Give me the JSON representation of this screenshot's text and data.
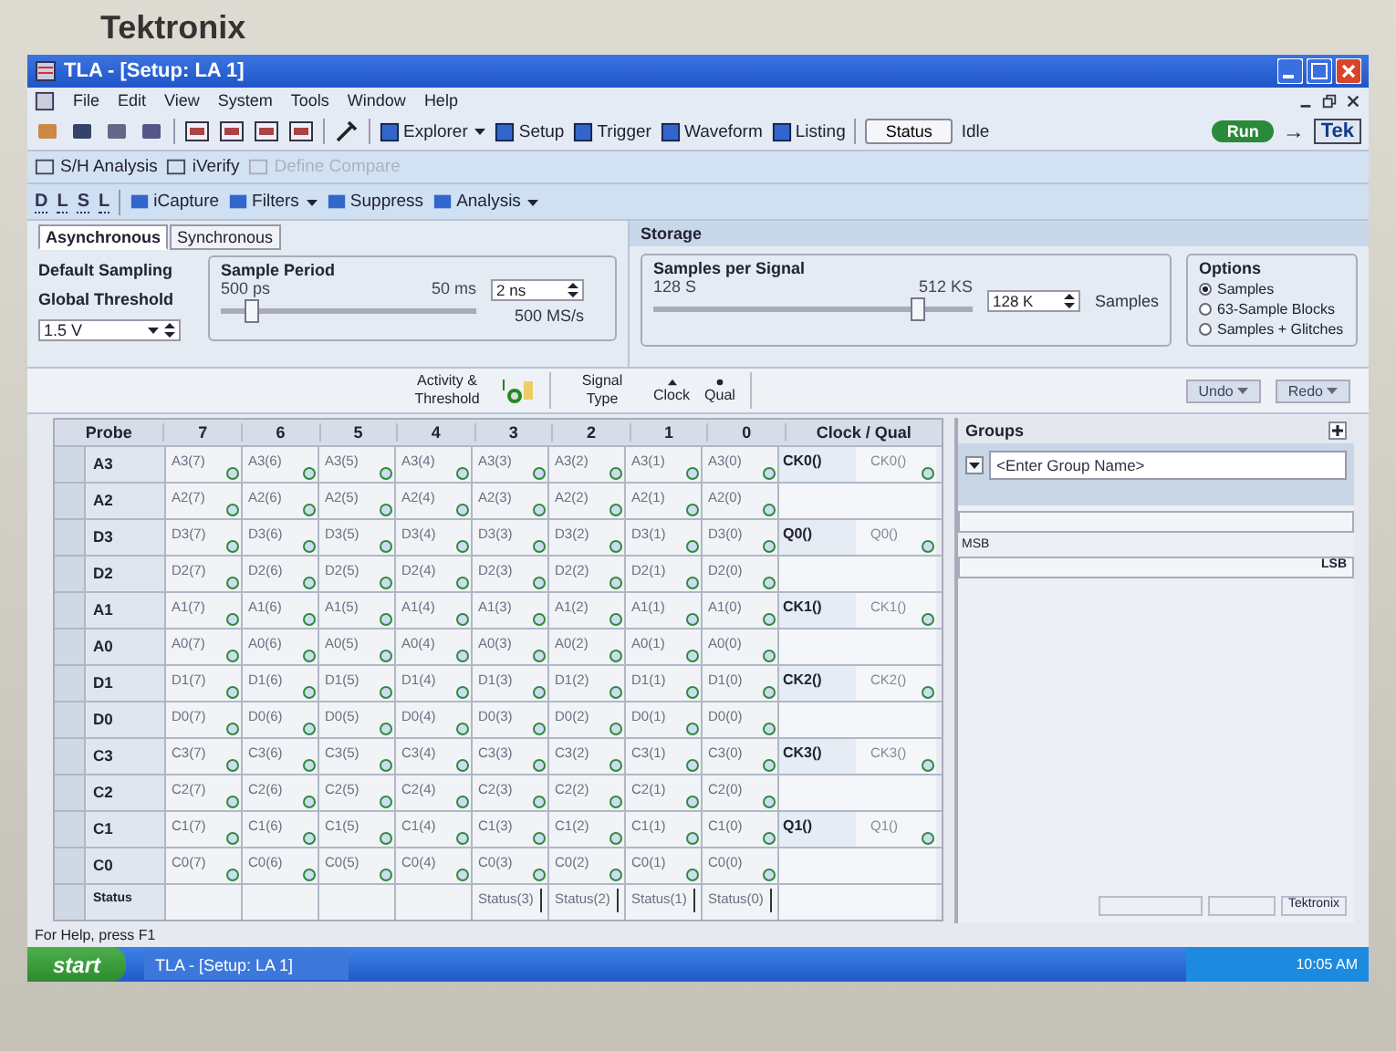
{
  "bezel": {
    "brand": "Tektronix"
  },
  "window": {
    "title": "TLA - [Setup: LA 1]"
  },
  "menu": [
    "File",
    "Edit",
    "View",
    "System",
    "Tools",
    "Window",
    "Help"
  ],
  "toolbar": {
    "nav": [
      {
        "label": "Explorer",
        "dropdown": true
      },
      {
        "label": "Setup",
        "dropdown": false
      },
      {
        "label": "Trigger",
        "dropdown": false
      },
      {
        "label": "Waveform",
        "dropdown": false
      },
      {
        "label": "Listing",
        "dropdown": false
      }
    ],
    "status_button": "Status",
    "status_value": "Idle",
    "run_button": "Run",
    "arrow": "→",
    "tek_button": "Tek"
  },
  "toolbar2": [
    {
      "label": "S/H Analysis",
      "disabled": false
    },
    {
      "label": "iVerify",
      "disabled": false
    },
    {
      "label": "Define Compare",
      "disabled": true
    }
  ],
  "toolbar3": {
    "windows": [
      "D",
      "L",
      "S",
      "L"
    ],
    "items": [
      {
        "label": "iCapture",
        "dropdown": false
      },
      {
        "label": "Filters",
        "dropdown": true
      },
      {
        "label": "Suppress",
        "dropdown": false
      },
      {
        "label": "Analysis",
        "dropdown": true
      }
    ]
  },
  "sampling": {
    "tabs": [
      {
        "label": "Asynchronous",
        "selected": true
      },
      {
        "label": "Synchronous",
        "selected": false
      }
    ],
    "default_sampling": "Default Sampling",
    "global_threshold": {
      "label": "Global Threshold",
      "value": "1.5 V"
    },
    "sample_period": {
      "label": "Sample Period",
      "min": "500 ps",
      "max": "50 ms",
      "level": 0.12,
      "value": "2 ns",
      "rate": "500 MS/s"
    }
  },
  "storage": {
    "title": "Storage",
    "samples_per_signal": {
      "label": "Samples per Signal",
      "min": "128 S",
      "max": "512 KS",
      "level": 0.83,
      "value": "128 K",
      "unit": "Samples"
    },
    "options": {
      "title": "Options",
      "items": [
        {
          "label": "Samples",
          "selected": true
        },
        {
          "label": "63-Sample Blocks",
          "selected": false
        },
        {
          "label": "Samples + Glitches",
          "selected": false
        }
      ]
    }
  },
  "legend": {
    "activity": "Activity & Threshold",
    "signal_type": "Signal Type",
    "clock": "Clock",
    "qual": "Qual",
    "undo": "Undo",
    "redo": "Redo"
  },
  "table": {
    "probe_header": "Probe",
    "bit_headers": [
      "7",
      "6",
      "5",
      "4",
      "3",
      "2",
      "1",
      "0"
    ],
    "clock_header": "Clock / Qual",
    "rows": [
      {
        "probe": "A3",
        "signals": [
          "A3(7)",
          "A3(6)",
          "A3(5)",
          "A3(4)",
          "A3(3)",
          "A3(2)",
          "A3(1)",
          "A3(0)"
        ],
        "clock": {
          "name": "CK0()",
          "alias": "CK0()"
        }
      },
      {
        "probe": "A2",
        "signals": [
          "A2(7)",
          "A2(6)",
          "A2(5)",
          "A2(4)",
          "A2(3)",
          "A2(2)",
          "A2(1)",
          "A2(0)"
        ]
      },
      {
        "probe": "D3",
        "signals": [
          "D3(7)",
          "D3(6)",
          "D3(5)",
          "D3(4)",
          "D3(3)",
          "D3(2)",
          "D3(1)",
          "D3(0)"
        ],
        "clock": {
          "name": "Q0()",
          "alias": "Q0()"
        }
      },
      {
        "probe": "D2",
        "signals": [
          "D2(7)",
          "D2(6)",
          "D2(5)",
          "D2(4)",
          "D2(3)",
          "D2(2)",
          "D2(1)",
          "D2(0)"
        ]
      },
      {
        "probe": "A1",
        "signals": [
          "A1(7)",
          "A1(6)",
          "A1(5)",
          "A1(4)",
          "A1(3)",
          "A1(2)",
          "A1(1)",
          "A1(0)"
        ],
        "clock": {
          "name": "CK1()",
          "alias": "CK1()"
        }
      },
      {
        "probe": "A0",
        "signals": [
          "A0(7)",
          "A0(6)",
          "A0(5)",
          "A0(4)",
          "A0(3)",
          "A0(2)",
          "A0(1)",
          "A0(0)"
        ]
      },
      {
        "probe": "D1",
        "signals": [
          "D1(7)",
          "D1(6)",
          "D1(5)",
          "D1(4)",
          "D1(3)",
          "D1(2)",
          "D1(1)",
          "D1(0)"
        ],
        "clock": {
          "name": "CK2()",
          "alias": "CK2()"
        }
      },
      {
        "probe": "D0",
        "signals": [
          "D0(7)",
          "D0(6)",
          "D0(5)",
          "D0(4)",
          "D0(3)",
          "D0(2)",
          "D0(1)",
          "D0(0)"
        ]
      },
      {
        "probe": "C3",
        "signals": [
          "C3(7)",
          "C3(6)",
          "C3(5)",
          "C3(4)",
          "C3(3)",
          "C3(2)",
          "C3(1)",
          "C3(0)"
        ],
        "clock": {
          "name": "CK3()",
          "alias": "CK3()"
        }
      },
      {
        "probe": "C2",
        "signals": [
          "C2(7)",
          "C2(6)",
          "C2(5)",
          "C2(4)",
          "C2(3)",
          "C2(2)",
          "C2(1)",
          "C2(0)"
        ]
      },
      {
        "probe": "C1",
        "signals": [
          "C1(7)",
          "C1(6)",
          "C1(5)",
          "C1(4)",
          "C1(3)",
          "C1(2)",
          "C1(1)",
          "C1(0)"
        ],
        "clock": {
          "name": "Q1()",
          "alias": "Q1()"
        }
      },
      {
        "probe": "C0",
        "signals": [
          "C0(7)",
          "C0(6)",
          "C0(5)",
          "C0(4)",
          "C0(3)",
          "C0(2)",
          "C0(1)",
          "C0(0)"
        ]
      }
    ],
    "status_row": {
      "label": "Status",
      "signals": [
        "Status(3)",
        "Status(2)",
        "Status(1)",
        "Status(0)"
      ]
    }
  },
  "groups": {
    "title": "Groups",
    "name_placeholder": "<Enter Group Name>",
    "msb": "MSB",
    "lsb": "LSB"
  },
  "footer_brand": "Tektronix",
  "status_bar": "For Help, press F1",
  "taskbar": {
    "start": "start",
    "task": "TLA - [Setup: LA 1]",
    "clock": "10:05 AM"
  }
}
